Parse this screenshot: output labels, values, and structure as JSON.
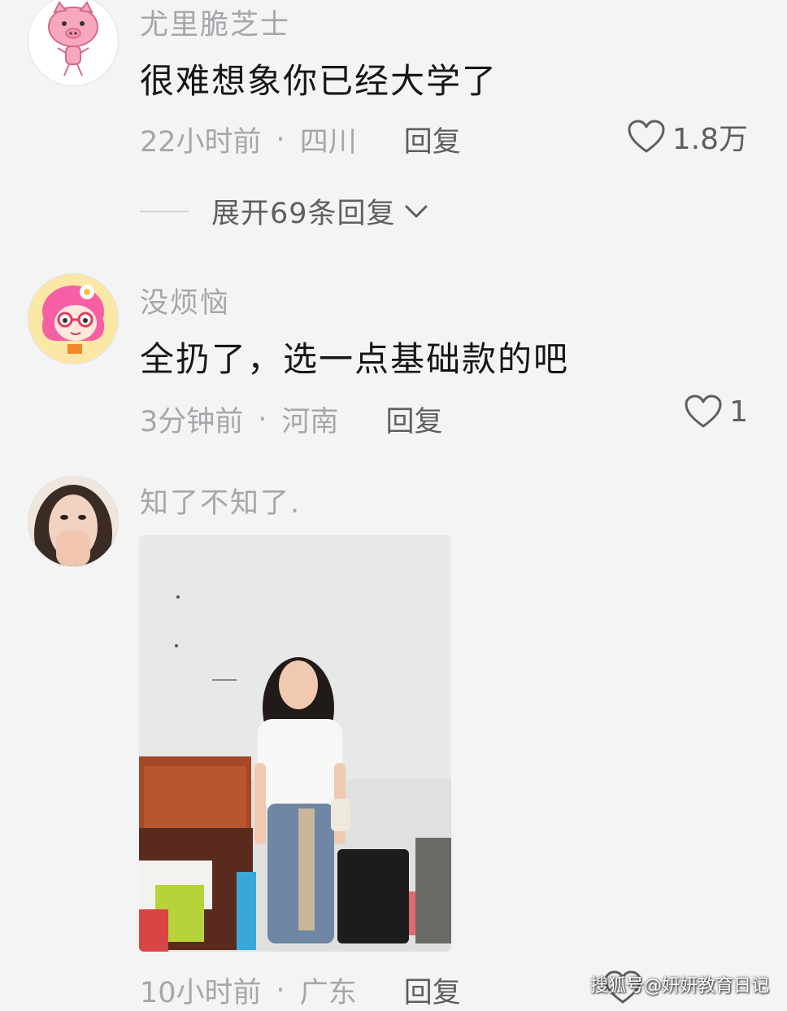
{
  "comments": [
    {
      "author": "尤里脆芝士",
      "text": "很难想象你已经大学了",
      "time": "22小时前",
      "separator": "·",
      "location": "四川",
      "reply_label": "回复",
      "likes": "1.8万",
      "expand_label": "展开69条回复"
    },
    {
      "author": "没烦恼",
      "text": "全扔了，选一点基础款的吧",
      "time": "3分钟前",
      "separator": "·",
      "location": "河南",
      "reply_label": "回复",
      "likes": "1"
    },
    {
      "author": "知了不知了.",
      "text": "",
      "time": "10小时前",
      "separator": "·",
      "location": "广东",
      "reply_label": "回复",
      "likes": ""
    }
  ],
  "watermark": "搜狐号@妍妍教育日记",
  "icons": {
    "like": "heart-outline-icon",
    "expand": "chevron-down-icon"
  },
  "colors": {
    "background": "#f4f4f5",
    "muted_text": "#a6a6ab",
    "secondary_text": "#5e5e63",
    "primary_text": "#161616"
  }
}
